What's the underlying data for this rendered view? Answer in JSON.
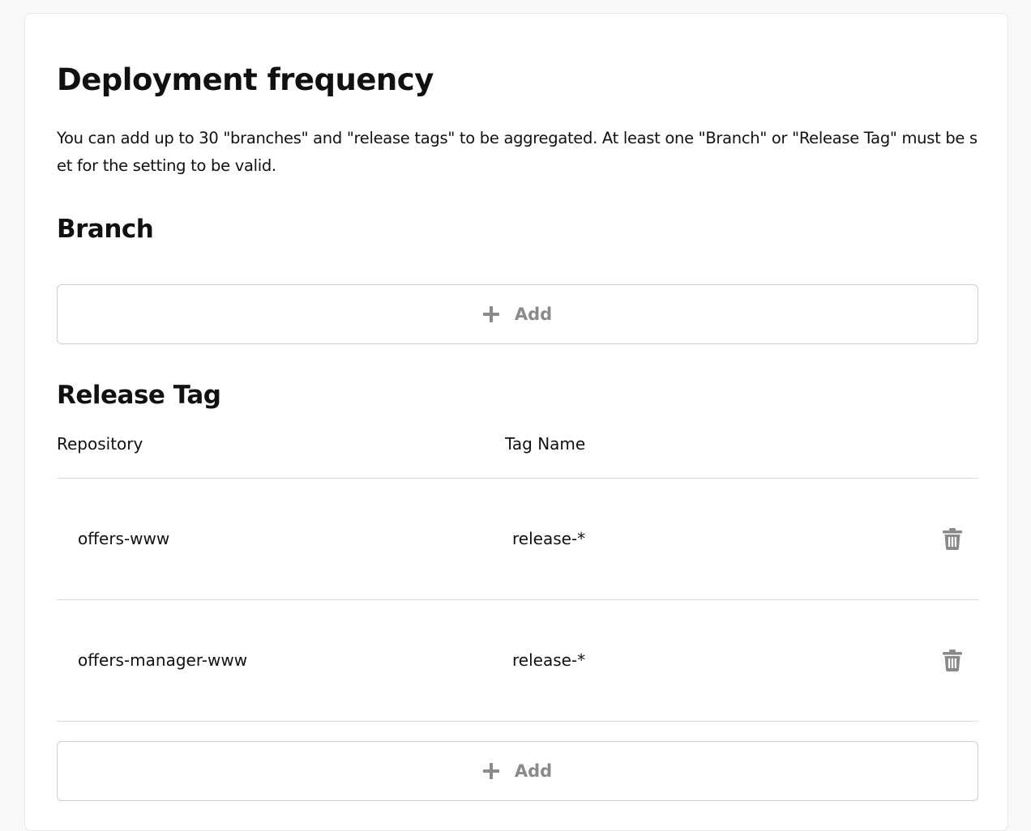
{
  "settings": {
    "title": "Deployment frequency",
    "description": "You can add up to 30 \"branches\" and \"release tags\" to be aggregated. At least one \"Branch\" or \"Release Tag\" must be set for the setting to be valid."
  },
  "branch": {
    "title": "Branch",
    "add_label": "Add"
  },
  "release_tag": {
    "title": "Release Tag",
    "columns": {
      "repository": "Repository",
      "tag_name": "Tag Name"
    },
    "rows": [
      {
        "repository": "offers-www",
        "tag_name": "release-*"
      },
      {
        "repository": "offers-manager-www",
        "tag_name": "release-*"
      }
    ],
    "add_label": "Add"
  },
  "icons": {
    "add": "plus-icon",
    "delete": "trash-icon"
  },
  "colors": {
    "muted": "#8a8a8a",
    "divider": "#d9d9d9",
    "border": "#cfcfcf"
  }
}
